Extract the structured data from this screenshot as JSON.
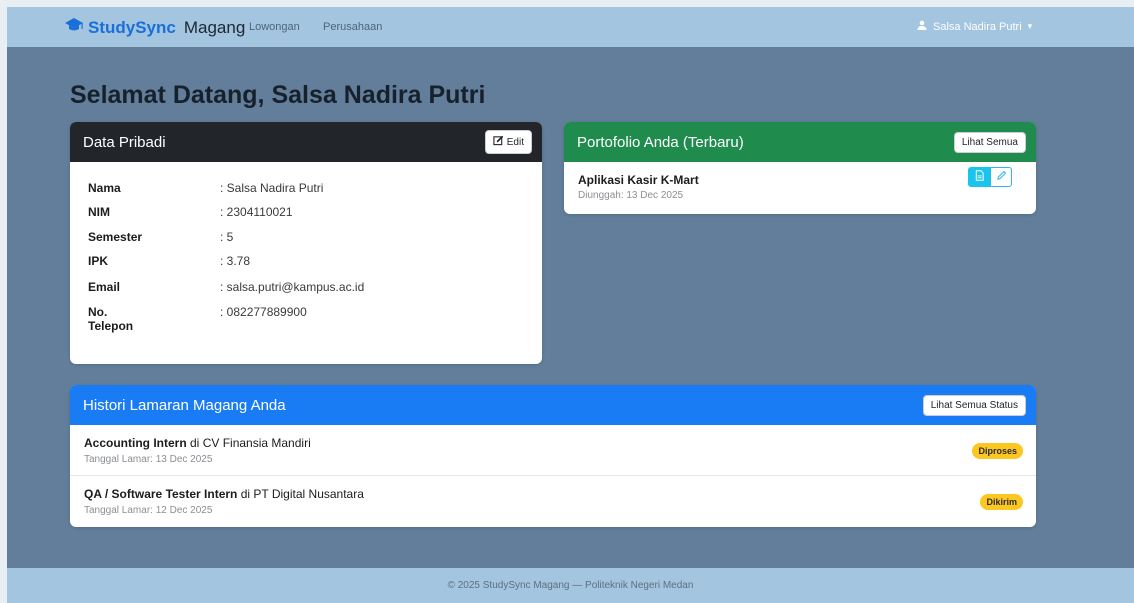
{
  "navbar": {
    "brand_primary": "StudySync",
    "brand_secondary": "Magang",
    "links": [
      "Lowongan",
      "Perusahaan"
    ],
    "user_name": "Salsa Nadira Putri",
    "caret": "▾"
  },
  "welcome": "Selamat Datang, Salsa Nadira Putri",
  "pribadi": {
    "title": "Data Pribadi",
    "edit_label": "Edit",
    "rows": [
      {
        "label": "Nama",
        "value": ": Salsa Nadira Putri"
      },
      {
        "label": "NIM",
        "value": ": 2304110021"
      },
      {
        "label": "Semester",
        "value": ": 5"
      },
      {
        "label": "IPK",
        "value": ": 3.78"
      },
      {
        "label": "Email",
        "value": ": salsa.putri@kampus.ac.id"
      },
      {
        "label": "No. Telepon",
        "value": ": 082277889900"
      }
    ]
  },
  "portfolio": {
    "title": "Portofolio Anda (Terbaru)",
    "button": "Lihat Semua",
    "item_title": "Aplikasi Kasir K-Mart",
    "item_date": "Diunggah: 13 Dec 2025"
  },
  "histori": {
    "title": "Histori Lamaran Magang Anda",
    "button": "Lihat Semua Status",
    "items": [
      {
        "position": "Accounting Intern",
        "connector": " di ",
        "company": "CV Finansia Mandiri",
        "date": "Tanggal Lamar: 13 Dec 2025",
        "status": "Diproses"
      },
      {
        "position": "QA / Software Tester Intern",
        "connector": " di ",
        "company": "PT Digital Nusantara",
        "date": "Tanggal Lamar: 12 Dec 2025",
        "status": "Dikirim"
      }
    ]
  },
  "footer": "© 2025 StudySync Magang — Politeknik Negeri Medan",
  "colors": {
    "brand": "#1b6fd8",
    "navbar": "#a3c5e0",
    "background": "#627e9a",
    "header_dark": "#22262a",
    "header_green": "#1f8b4c",
    "header_blue": "#1a7cf5",
    "badge_warning": "#fdc721"
  },
  "icons": {
    "brand": "graduation-cap-icon",
    "user": "user-icon",
    "edit": "pencil-square-icon",
    "document": "file-icon",
    "pencil": "pencil-icon"
  }
}
